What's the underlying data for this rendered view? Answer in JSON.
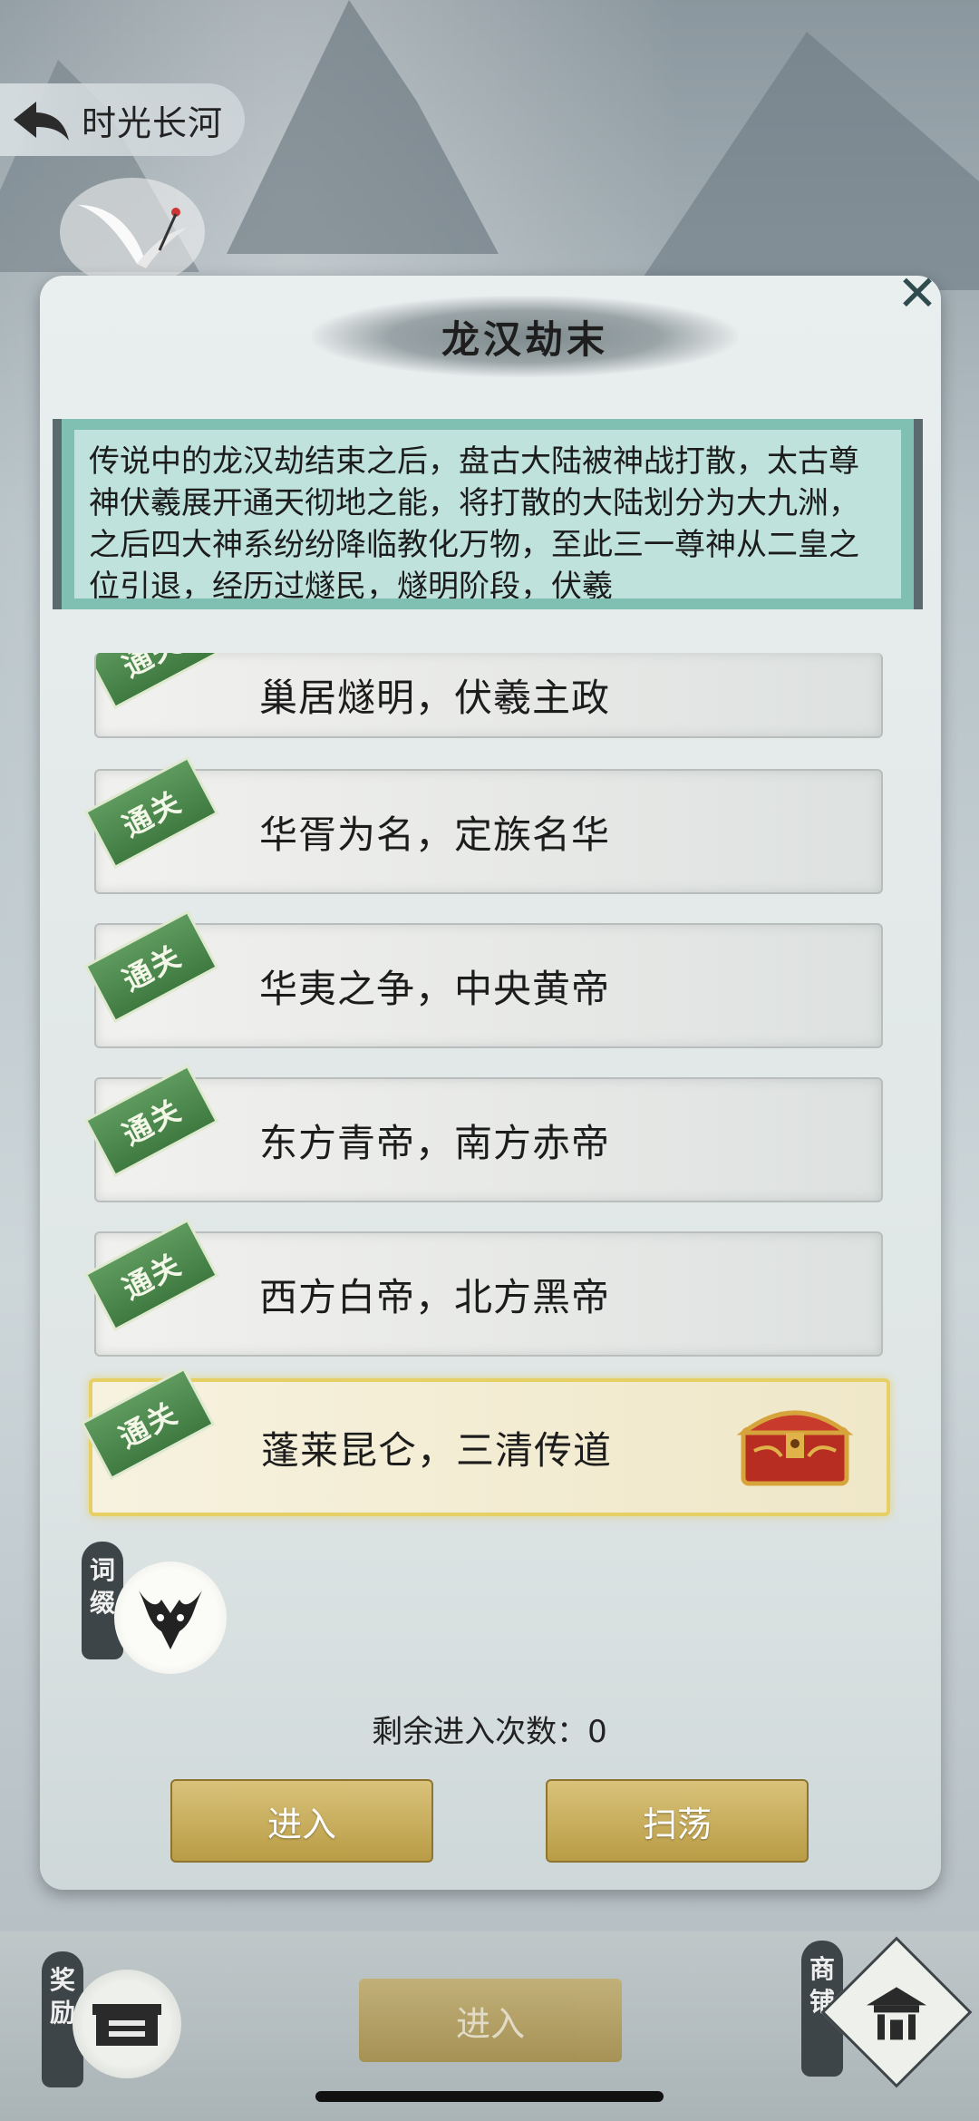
{
  "header": {
    "back_icon": "back-arrow-icon",
    "title": "时光长河"
  },
  "modal": {
    "title": "龙汉劫末",
    "close_icon": "close-icon",
    "description": "传说中的龙汉劫结束之后，盘古大陆被神战打散，太古尊神伏羲展开通天彻地之能，将打散的大陆划分为大九洲，之后四大神系纷纷降临教化万物，至此三一尊神从二皇之位引退，经历过燧民，燧明阶段，伏羲",
    "stages": [
      {
        "label": "巢居燧明，伏羲主政",
        "badge": "通关",
        "active": false
      },
      {
        "label": "华胥为名，定族名华",
        "badge": "通关",
        "active": false
      },
      {
        "label": "华夷之争，中央黄帝",
        "badge": "通关",
        "active": false
      },
      {
        "label": "东方青帝，南方赤帝",
        "badge": "通关",
        "active": false
      },
      {
        "label": "西方白帝，北方黑帝",
        "badge": "通关",
        "active": false
      },
      {
        "label": "蓬莱昆仑，三清传道",
        "badge": "通关",
        "active": true,
        "reward_icon": "treasure-chest-icon"
      }
    ],
    "affix": {
      "tag": "词缀",
      "icon": "demon-mask-icon"
    },
    "remaining_label": "剩余进入次数：",
    "remaining_value": "0",
    "enter_button": "进入",
    "sweep_button": "扫荡"
  },
  "bottom": {
    "reward_tag": "奖励",
    "reward_icon": "reward-box-icon",
    "enter_button": "进入",
    "shop_tag": "商铺",
    "shop_icon": "shop-pavilion-icon"
  },
  "colors": {
    "badge_green": "#4a8a4c",
    "button_gold": "#c9b061",
    "active_border": "#e6cf64"
  }
}
